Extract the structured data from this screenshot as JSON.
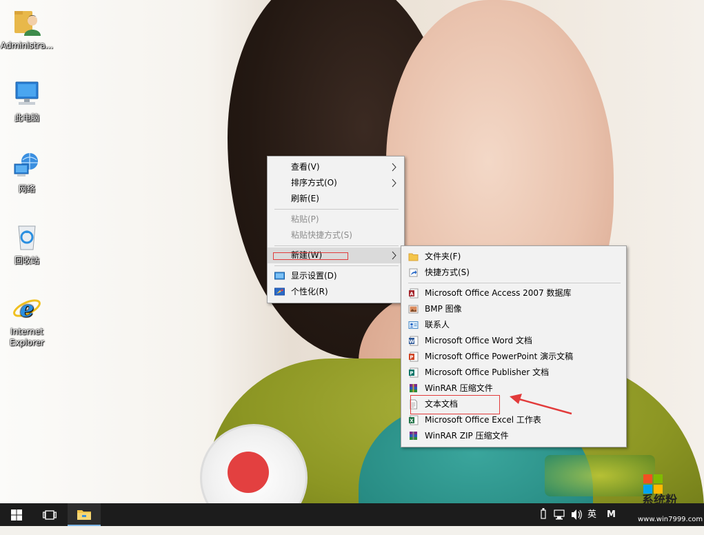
{
  "desktop": {
    "icons": [
      {
        "label": "Administra...",
        "icon": "user-folder-icon"
      },
      {
        "label": "此电脑",
        "icon": "computer-icon"
      },
      {
        "label": "网络",
        "icon": "network-icon"
      },
      {
        "label": "回收站",
        "icon": "recycle-bin-icon"
      },
      {
        "label": "Internet Explorer",
        "icon": "internet-explorer-icon"
      }
    ]
  },
  "context_menu": {
    "items": {
      "view": "查看(V)",
      "sort": "排序方式(O)",
      "refresh": "刷新(E)",
      "paste": "粘贴(P)",
      "paste_shortcut": "粘贴快捷方式(S)",
      "new": "新建(W)",
      "display_settings": "显示设置(D)",
      "personalize": "个性化(R)"
    },
    "submenu_arrow": ">"
  },
  "new_submenu": {
    "items": [
      {
        "label": "文件夹(F)",
        "icon": "folder-icon"
      },
      {
        "label": "快捷方式(S)",
        "icon": "shortcut-icon"
      },
      {
        "label": "Microsoft Office Access 2007 数据库",
        "icon": "access-icon"
      },
      {
        "label": "BMP 图像",
        "icon": "bmp-image-icon"
      },
      {
        "label": "联系人",
        "icon": "contact-icon"
      },
      {
        "label": "Microsoft Office Word 文档",
        "icon": "word-icon"
      },
      {
        "label": "Microsoft Office PowerPoint 演示文稿",
        "icon": "powerpoint-icon"
      },
      {
        "label": "Microsoft Office Publisher 文档",
        "icon": "publisher-icon"
      },
      {
        "label": "WinRAR 压缩文件",
        "icon": "winrar-icon"
      },
      {
        "label": "文本文档",
        "icon": "text-document-icon"
      },
      {
        "label": "Microsoft Office Excel 工作表",
        "icon": "excel-icon"
      },
      {
        "label": "WinRAR ZIP 压缩文件",
        "icon": "winrar-zip-icon"
      }
    ]
  },
  "taskbar": {
    "start_icon": "windows-start-icon",
    "task_view_icon": "task-view-icon",
    "explorer_icon": "file-explorer-icon",
    "ime_label": "英",
    "ime_mode": "M"
  },
  "watermark": {
    "site_name": "系统粉",
    "site_url": "www.win7999.com"
  },
  "colors": {
    "taskbar": "#1c1c1c",
    "menu_bg": "#f2f2f2",
    "highlight": "#dadada",
    "annotation_red": "#e23b3b"
  }
}
